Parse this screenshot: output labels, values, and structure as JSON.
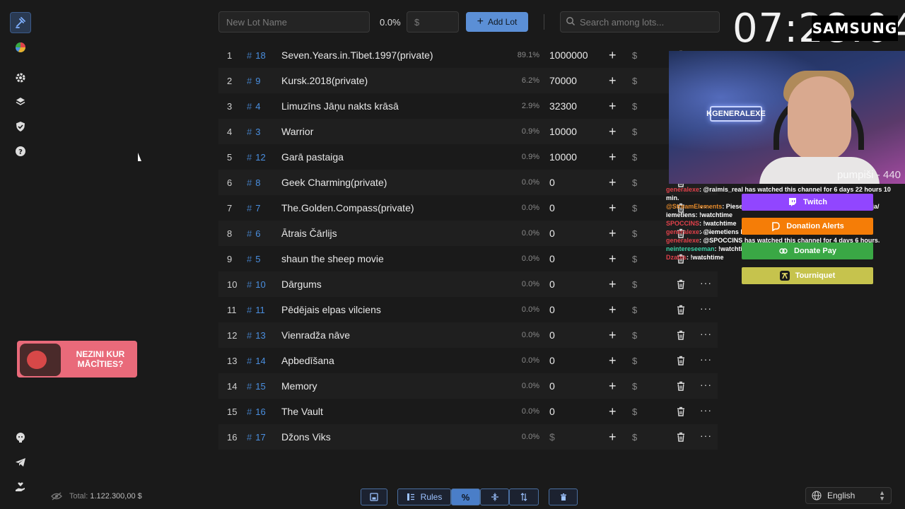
{
  "topbar": {
    "lot_name_placeholder": "New Lot Name",
    "percent": "0.0%",
    "amount_placeholder": "$",
    "add_lot_label": "Add Lot",
    "search_placeholder": "Search among lots..."
  },
  "overlay": {
    "clock": "07:28:04",
    "tv_brand": "SAMSUNG",
    "cam_sign": "KGENERALEXE",
    "cam_caption": "pumpiši - 440"
  },
  "lots": [
    {
      "index": "1",
      "id": "18",
      "name": "Seven.Years.in.Tibet.1997(private)",
      "pct": "89.1%",
      "amount": "1000000",
      "dollar": "$"
    },
    {
      "index": "2",
      "id": "9",
      "name": "Kursk.2018(private)",
      "pct": "6.2%",
      "amount": "70000",
      "dollar": "$"
    },
    {
      "index": "3",
      "id": "4",
      "name": "Limuzīns Jāņu nakts krāsā",
      "pct": "2.9%",
      "amount": "32300",
      "dollar": "$"
    },
    {
      "index": "4",
      "id": "3",
      "name": "Warrior",
      "pct": "0.9%",
      "amount": "10000",
      "dollar": "$"
    },
    {
      "index": "5",
      "id": "12",
      "name": "Garā pastaiga",
      "pct": "0.9%",
      "amount": "10000",
      "dollar": "$"
    },
    {
      "index": "6",
      "id": "8",
      "name": "Geek Charming(private)",
      "pct": "0.0%",
      "amount": "0",
      "dollar": "$"
    },
    {
      "index": "7",
      "id": "7",
      "name": "The.Golden.Compass(private)",
      "pct": "0.0%",
      "amount": "0",
      "dollar": "$"
    },
    {
      "index": "8",
      "id": "6",
      "name": "Ātrais Čārlijs",
      "pct": "0.0%",
      "amount": "0",
      "dollar": "$"
    },
    {
      "index": "9",
      "id": "5",
      "name": "shaun the sheep movie",
      "pct": "0.0%",
      "amount": "0",
      "dollar": "$"
    },
    {
      "index": "10",
      "id": "10",
      "name": "Dārgums",
      "pct": "0.0%",
      "amount": "0",
      "dollar": "$"
    },
    {
      "index": "11",
      "id": "11",
      "name": "Pēdējais elpas vilciens",
      "pct": "0.0%",
      "amount": "0",
      "dollar": "$"
    },
    {
      "index": "12",
      "id": "13",
      "name": "Vienradža nāve",
      "pct": "0.0%",
      "amount": "0",
      "dollar": "$"
    },
    {
      "index": "13",
      "id": "14",
      "name": "Apbedīšana",
      "pct": "0.0%",
      "amount": "0",
      "dollar": "$"
    },
    {
      "index": "14",
      "id": "15",
      "name": "Memory",
      "pct": "0.0%",
      "amount": "0",
      "dollar": "$"
    },
    {
      "index": "15",
      "id": "16",
      "name": "The Vault",
      "pct": "0.0%",
      "amount": "0",
      "dollar": "$"
    },
    {
      "index": "16",
      "id": "17",
      "name": "Džons Viks",
      "pct": "0.0%",
      "amount": "$",
      "dollar": "$"
    }
  ],
  "chat": [
    {
      "user": "generalexe",
      "color": "#e0414a",
      "text": ": @raimis_real has watched this channel for 6 days 22 hours 10 min."
    },
    {
      "user": "@StreamElements",
      "color": "#e58a2a",
      "text": ": Pieseko man IG https://www.instagram.com/lilileja/"
    },
    {
      "user": "iemetiens",
      "color": "#ffffff",
      "text": ": !watchtime"
    },
    {
      "user": "SPOCCINS",
      "color": "#e0414a",
      "text": ": !watchtime"
    },
    {
      "user": "generalexe",
      "color": "#e0414a",
      "text": ": @iemetiens has watched this channel for 5 h 25 min."
    },
    {
      "user": "generalexe",
      "color": "#e0414a",
      "text": ": @SPOCCINS has watched this channel for 4 days 6 hours."
    },
    {
      "user": "neintereseeman",
      "color": "#3ad1a6",
      "text": ": !watchtime"
    },
    {
      "user": "Dzabis",
      "color": "#e0414a",
      "text": ": !watchtime"
    }
  ],
  "donations": {
    "twitch": "Twitch",
    "donation_alerts": "Donation Alerts",
    "donate_pay": "Donate Pay",
    "tourniquet": "Tourniquet"
  },
  "promo": {
    "text": "NEZINI KUR MĀCĪTIES?"
  },
  "footer": {
    "total_label": "Total:",
    "total_value": "1.122.300,00 $",
    "rules_label": "Rules",
    "language": "English"
  },
  "colors": {
    "accent": "#5b8fd6",
    "link": "#4a8fe0",
    "twitch": "#9146ff",
    "donation_alerts": "#f57d07",
    "donate_pay": "#3aa845",
    "tourniquet": "#c6c34d"
  }
}
